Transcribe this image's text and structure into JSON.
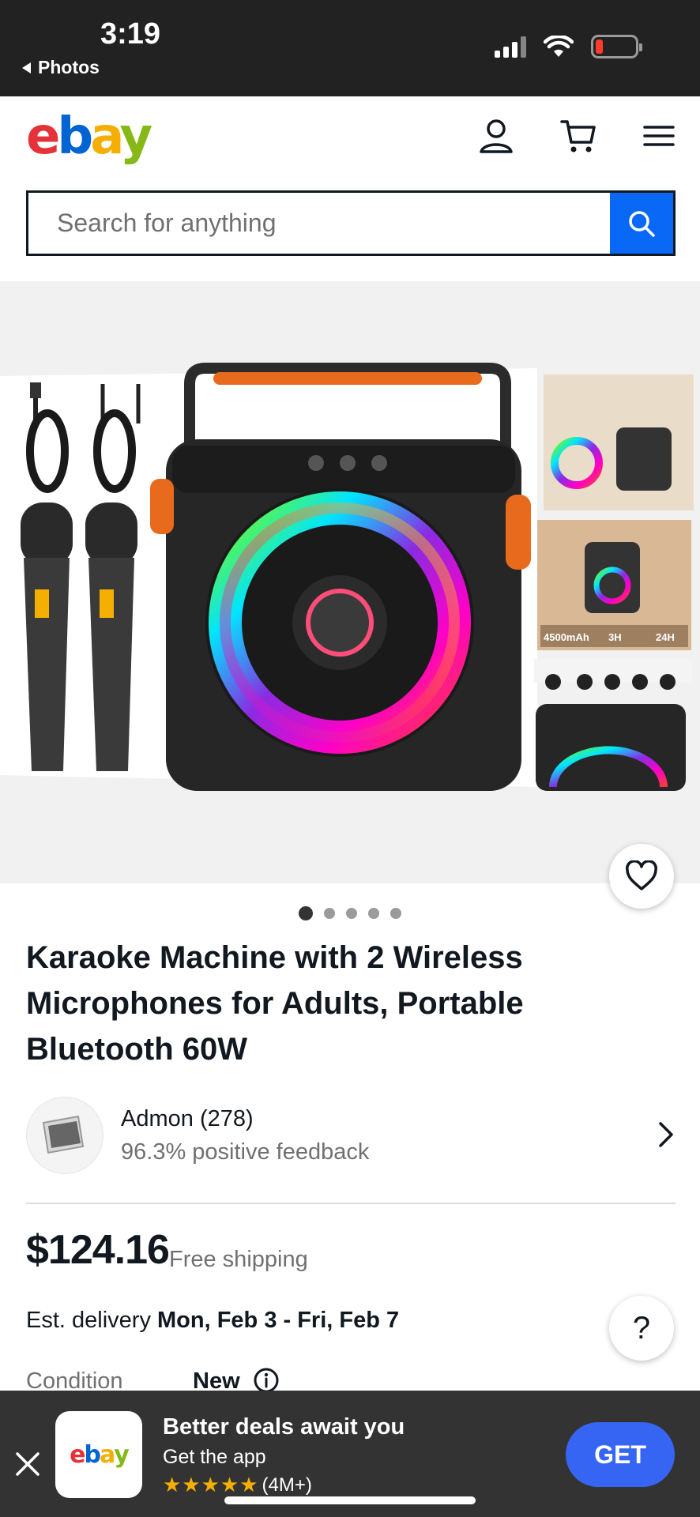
{
  "status_bar": {
    "time": "3:19",
    "back_label": "Photos",
    "battery_color": "#ff3b30"
  },
  "header": {
    "logo_letters": [
      "e",
      "b",
      "a",
      "y"
    ],
    "icons": [
      "account-icon",
      "cart-icon",
      "menu-icon"
    ]
  },
  "search": {
    "placeholder": "Search for anything",
    "value": "",
    "button_color": "#0968f6"
  },
  "gallery": {
    "image_count": 5,
    "active_index": 0,
    "main_image_alt": "Karaoke speaker with two wireless microphones",
    "thumb_labels": [
      "4500mAh",
      "3H",
      "24H"
    ]
  },
  "listing": {
    "title": "Karaoke Machine with 2 Wireless Microphones for Adults, Portable Bluetooth 60W",
    "seller": {
      "name": "Admon (278)",
      "feedback": "96.3% positive feedback"
    },
    "price": "$124.16",
    "shipping": "Free shipping",
    "delivery_prefix": "Est. delivery ",
    "delivery_dates": "Mon, Feb 3 - Fri, Feb 7",
    "condition_label": "Condition",
    "condition_value": "New"
  },
  "help": {
    "label": "?"
  },
  "app_banner": {
    "title": "Better deals await you",
    "subtitle": "Get the app",
    "stars": "★★★★★",
    "rating_count": "(4M+)",
    "get_label": "GET"
  }
}
